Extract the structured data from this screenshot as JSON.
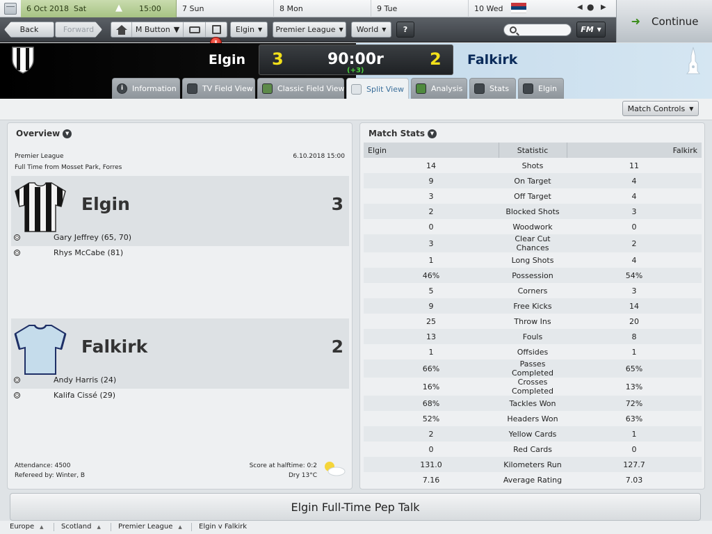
{
  "calendar": {
    "today_date": "6 Oct 2018",
    "today_day": "Sat",
    "time": "15:00",
    "days": [
      {
        "num": "7",
        "name": "Sun"
      },
      {
        "num": "8",
        "name": "Mon"
      },
      {
        "num": "9",
        "name": "Tue"
      },
      {
        "num": "10",
        "name": "Wed"
      }
    ]
  },
  "toolbar": {
    "back": "Back",
    "forward": "Forward",
    "m_button": "M Button",
    "alert_count": "!",
    "club_menu": "Elgin",
    "competition_menu": "Premier League",
    "world_menu": "World",
    "help": "?",
    "search_placeholder": "",
    "fm_menu": "FM",
    "continue": "Continue"
  },
  "match": {
    "home_team": "Elgin",
    "away_team": "Falkirk",
    "home_score": "3",
    "away_score": "2",
    "clock": "90:00r",
    "added_time": "(+3)"
  },
  "tabs": [
    {
      "label": "Information",
      "icon": "info-icon"
    },
    {
      "label": "TV Field View",
      "icon": "tv-icon"
    },
    {
      "label": "Classic Field View",
      "icon": "pitch-icon"
    },
    {
      "label": "Split View",
      "icon": "split-view-icon"
    },
    {
      "label": "Analysis",
      "icon": "analysis-icon"
    },
    {
      "label": "Stats",
      "icon": "stats-icon"
    },
    {
      "label": "Elgin",
      "icon": "team-icon"
    }
  ],
  "active_tab": "Split View",
  "match_controls": "Match Controls",
  "overview": {
    "title": "Overview",
    "competition": "Premier League",
    "datetime": "6.10.2018 15:00",
    "venue": "Full Time from Mosset Park, Forres",
    "home": {
      "name": "Elgin",
      "score": "3",
      "scorers": [
        "Gary Jeffrey (65, 70)",
        "Rhys McCabe (81)"
      ]
    },
    "away": {
      "name": "Falkirk",
      "score": "2",
      "scorers": [
        "Andy Harris (24)",
        "Kalifa Cissé (29)"
      ]
    },
    "attendance": "Attendance: 4500",
    "referee": "Refereed by: Winter, B",
    "halftime": "Score at halftime: 0:2",
    "weather": "Dry 13°C"
  },
  "stats": {
    "title": "Match Stats",
    "header": {
      "home": "Elgin",
      "stat": "Statistic",
      "away": "Falkirk"
    },
    "rows": [
      {
        "home": "14",
        "stat": "Shots",
        "away": "11"
      },
      {
        "home": "9",
        "stat": "On Target",
        "away": "4"
      },
      {
        "home": "3",
        "stat": "Off Target",
        "away": "4"
      },
      {
        "home": "2",
        "stat": "Blocked Shots",
        "away": "3"
      },
      {
        "home": "0",
        "stat": "Woodwork",
        "away": "0"
      },
      {
        "home": "3",
        "stat": "Clear Cut Chances",
        "away": "2"
      },
      {
        "home": "1",
        "stat": "Long Shots",
        "away": "4"
      },
      {
        "home": "46%",
        "stat": "Possession",
        "away": "54%"
      },
      {
        "home": "5",
        "stat": "Corners",
        "away": "3"
      },
      {
        "home": "9",
        "stat": "Free Kicks",
        "away": "14"
      },
      {
        "home": "25",
        "stat": "Throw Ins",
        "away": "20"
      },
      {
        "home": "13",
        "stat": "Fouls",
        "away": "8"
      },
      {
        "home": "1",
        "stat": "Offsides",
        "away": "1"
      },
      {
        "home": "66%",
        "stat": "Passes Completed",
        "away": "65%"
      },
      {
        "home": "16%",
        "stat": "Crosses Completed",
        "away": "13%"
      },
      {
        "home": "68%",
        "stat": "Tackles Won",
        "away": "72%"
      },
      {
        "home": "52%",
        "stat": "Headers Won",
        "away": "63%"
      },
      {
        "home": "2",
        "stat": "Yellow Cards",
        "away": "1"
      },
      {
        "home": "0",
        "stat": "Red Cards",
        "away": "0"
      },
      {
        "home": "131.0",
        "stat": "Kilometers Run",
        "away": "127.7"
      },
      {
        "home": "7.16",
        "stat": "Average Rating",
        "away": "7.03"
      }
    ]
  },
  "pep_talk": "Elgin Full-Time Pep Talk",
  "breadcrumb": [
    "Europe",
    "Scotland",
    "Premier League",
    "Elgin v Falkirk"
  ],
  "colors": {
    "score_yellow": "#f2e01a",
    "added_time_green": "#4bd23c",
    "away_name_navy": "#0a2b5a",
    "calendar_today_green": "#a7c384",
    "active_tab_text": "#3a6e9a"
  }
}
